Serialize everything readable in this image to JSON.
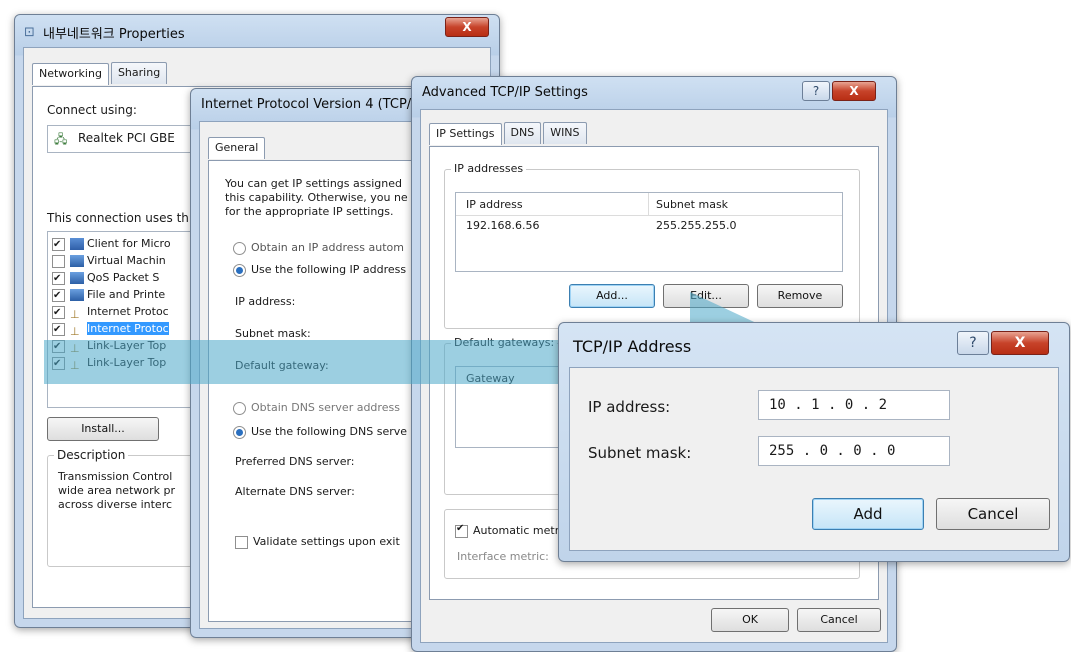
{
  "win1": {
    "title": "내부네트워크 Properties",
    "close": "X",
    "tabs": [
      "Networking",
      "Sharing"
    ],
    "connect_using": "Connect using:",
    "adapter": "Realtek PCI GBE",
    "uses_label": "This connection uses th",
    "items": [
      {
        "label": "Client for Micro",
        "checked": true
      },
      {
        "label": "Virtual Machin",
        "checked": false
      },
      {
        "label": "QoS Packet S",
        "checked": true
      },
      {
        "label": "File and Printe",
        "checked": true
      },
      {
        "label": "Internet Protoc",
        "checked": true
      },
      {
        "label": "Internet Protoc",
        "checked": true,
        "selected": true
      },
      {
        "label": "Link-Layer Top",
        "checked": true
      },
      {
        "label": "Link-Layer Top",
        "checked": true
      }
    ],
    "install": "Install...",
    "description_label": "Description",
    "description_text": [
      "Transmission Control",
      "wide area network pr",
      "across diverse interc"
    ]
  },
  "win2": {
    "title": "Internet Protocol Version 4 (TCP/I",
    "tab": "General",
    "intro": [
      "You can get IP settings assigned",
      "this capability. Otherwise, you ne",
      "for the appropriate IP settings."
    ],
    "obtain_ip": "Obtain an IP address autom",
    "use_ip": "Use the following IP address",
    "ip_label": "IP address:",
    "subnet_label": "Subnet mask:",
    "gateway_label": "Default gateway:",
    "obtain_dns": "Obtain DNS server address",
    "use_dns": "Use the following DNS serve",
    "preferred_dns": "Preferred DNS server:",
    "alternate_dns": "Alternate DNS server:",
    "validate": "Validate settings upon exit"
  },
  "win3": {
    "title": "Advanced TCP/IP Settings",
    "help": "?",
    "close": "X",
    "tabs": [
      "IP Settings",
      "DNS",
      "WINS"
    ],
    "ip_group": "IP addresses",
    "col_ip": "IP address",
    "col_mask": "Subnet mask",
    "row_ip": "192.168.6.56",
    "row_mask": "255.255.255.0",
    "add": "Add...",
    "edit": "Edit...",
    "remove": "Remove",
    "gw_group": "Default gateways:",
    "col_gateway": "Gateway",
    "auto_metric": "Automatic metr",
    "interface_metric": "Interface metric:",
    "ok": "OK",
    "cancel": "Cancel"
  },
  "win4": {
    "title": "TCP/IP Address",
    "help": "?",
    "close": "X",
    "ip_label": "IP address:",
    "ip_value": "10  .  1  .  0  .  2",
    "mask_label": "Subnet mask:",
    "mask_value": "255  .  0  .  0  .  0",
    "add": "Add",
    "cancel": "Cancel"
  },
  "colors": {
    "arrow": "#4aa8c8",
    "selection": "#3399ff"
  }
}
